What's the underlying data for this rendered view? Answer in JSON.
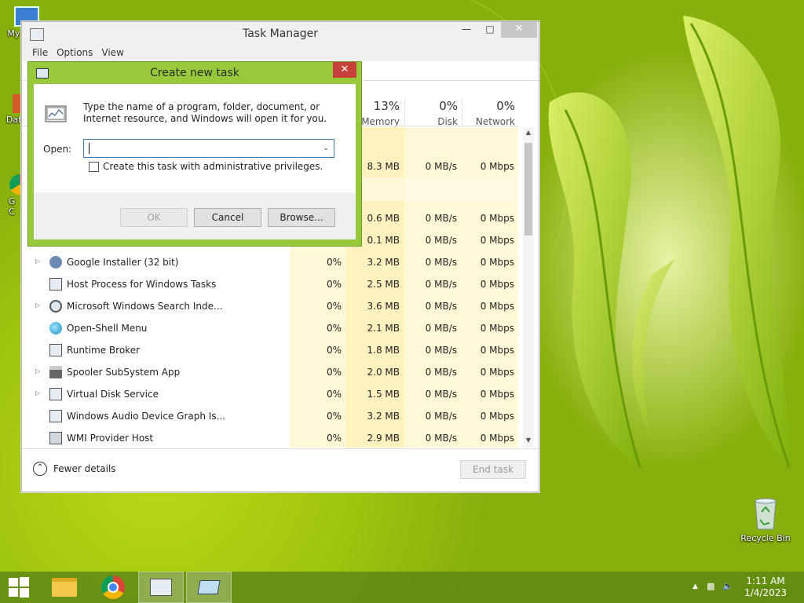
{
  "desktop": {
    "icons": [
      {
        "label": "My C"
      },
      {
        "label": "Data"
      },
      {
        "label": "G\nC"
      }
    ],
    "recycle_bin_label": "Recycle Bin"
  },
  "task_manager": {
    "title": "Task Manager",
    "menu": [
      "File",
      "Options",
      "View"
    ],
    "columns": [
      {
        "pct": "13%",
        "name": "Memory"
      },
      {
        "pct": "0%",
        "name": "Disk"
      },
      {
        "pct": "0%",
        "name": "Network"
      }
    ],
    "partial_rows": [
      {
        "memory": "8.3 MB",
        "disk": "0 MB/s",
        "network": "0 Mbps"
      },
      {
        "memory": "0.6 MB",
        "disk": "0 MB/s",
        "network": "0 Mbps"
      },
      {
        "memory": "0.1 MB",
        "disk": "0 MB/s",
        "network": "0 Mbps"
      }
    ],
    "rows": [
      {
        "name": "Google Installer (32 bit)",
        "expandable": true,
        "icon": "installer-icon",
        "cpu": "0%",
        "memory": "3.2 MB",
        "disk": "0 MB/s",
        "network": "0 Mbps"
      },
      {
        "name": "Host Process for Windows Tasks",
        "expandable": false,
        "icon": "window-app-icon",
        "cpu": "0%",
        "memory": "2.5 MB",
        "disk": "0 MB/s",
        "network": "0 Mbps"
      },
      {
        "name": "Microsoft Windows Search Inde...",
        "expandable": true,
        "icon": "search-indexer-icon",
        "cpu": "0%",
        "memory": "3.6 MB",
        "disk": "0 MB/s",
        "network": "0 Mbps"
      },
      {
        "name": "Open-Shell Menu",
        "expandable": false,
        "icon": "shell-icon",
        "cpu": "0%",
        "memory": "2.1 MB",
        "disk": "0 MB/s",
        "network": "0 Mbps"
      },
      {
        "name": "Runtime Broker",
        "expandable": false,
        "icon": "window-app-icon",
        "cpu": "0%",
        "memory": "1.8 MB",
        "disk": "0 MB/s",
        "network": "0 Mbps"
      },
      {
        "name": "Spooler SubSystem App",
        "expandable": true,
        "icon": "printer-icon",
        "cpu": "0%",
        "memory": "2.0 MB",
        "disk": "0 MB/s",
        "network": "0 Mbps"
      },
      {
        "name": "Virtual Disk Service",
        "expandable": true,
        "icon": "window-app-icon",
        "cpu": "0%",
        "memory": "1.5 MB",
        "disk": "0 MB/s",
        "network": "0 Mbps"
      },
      {
        "name": "Windows Audio Device Graph Is...",
        "expandable": false,
        "icon": "window-app-icon",
        "cpu": "0%",
        "memory": "3.2 MB",
        "disk": "0 MB/s",
        "network": "0 Mbps"
      },
      {
        "name": "WMI Provider Host",
        "expandable": false,
        "icon": "wmi-icon",
        "cpu": "0%",
        "memory": "2.9 MB",
        "disk": "0 MB/s",
        "network": "0 Mbps"
      }
    ],
    "fewer_details": "Fewer details",
    "end_task": "End task"
  },
  "dialog": {
    "title": "Create new task",
    "message": "Type the name of a program, folder, document, or Internet resource, and Windows will open it for you.",
    "open_label": "Open:",
    "open_value": "",
    "admin_checkbox": "Create this task with administrative privileges.",
    "ok": "OK",
    "cancel": "Cancel",
    "browse": "Browse..."
  },
  "taskbar": {
    "time": "1:11 AM",
    "date": "1/4/2023"
  },
  "colors": {
    "dialog_frame": "#97c93b",
    "close_red": "#c7413a",
    "column_highlight": "#fff4c4"
  }
}
